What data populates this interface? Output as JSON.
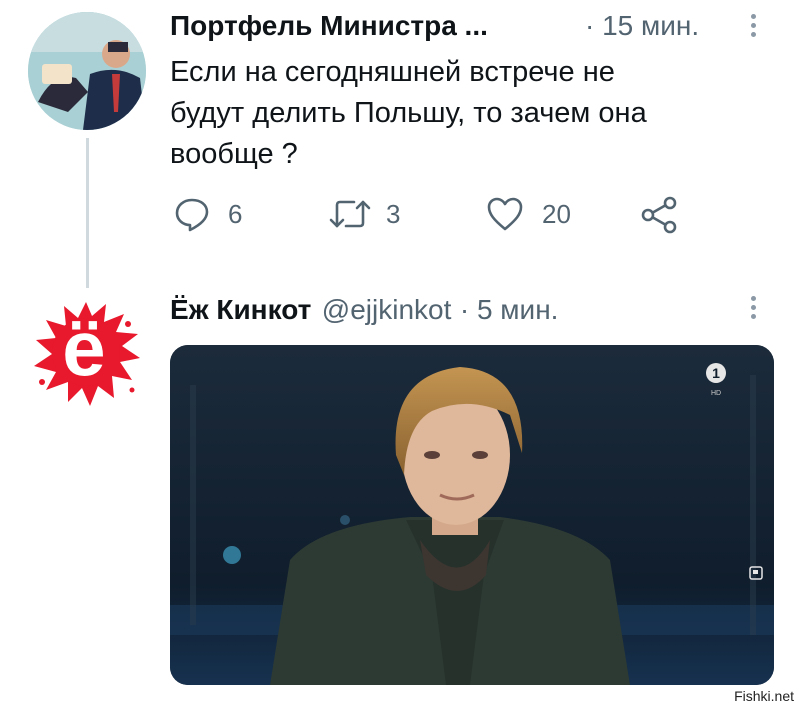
{
  "tweet1": {
    "author_name": "Портфель Министра ...",
    "time": "· 15 мин.",
    "lines": [
      "Если на сегодняшней встрече не",
      "будут делить Польшу, то зачем она",
      "вообще ?"
    ],
    "actions": {
      "reply_count": "6",
      "retweet_count": "3",
      "like_count": "20"
    },
    "avatar_icon": "person-photo-avatar",
    "menu_icon": "more-vertical-icon"
  },
  "tweet2": {
    "author_name": "Ёж Кинкот",
    "handle": "@ejjkinkot",
    "time": "· 5 мин.",
    "avatar_letter": "ё",
    "avatar_color": "#e8192c",
    "media_description_icon": "video-still-image",
    "channel_logo": "1",
    "channel_logo_sub": "HD"
  },
  "watermark": "Fishki.net",
  "colors": {
    "text": "#0f1419",
    "muted": "#536471",
    "thread_line": "#cfd9de"
  }
}
